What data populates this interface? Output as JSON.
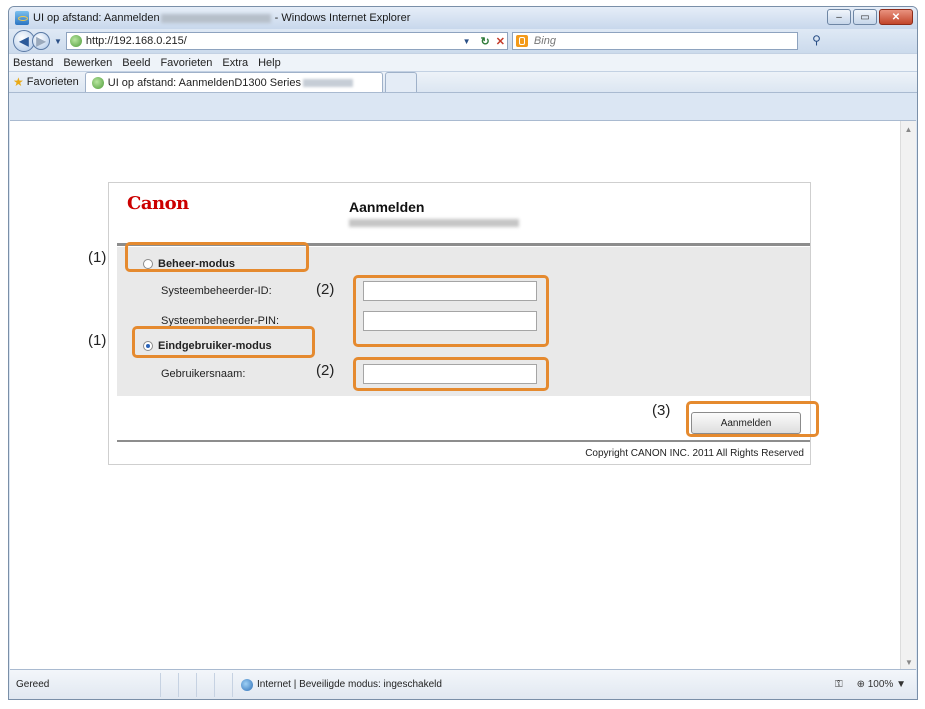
{
  "window": {
    "title_prefix": "UI op afstand: Aanmelden",
    "title_suffix": " - Windows Internet Explorer",
    "controls": [
      "–",
      "▭",
      "✕"
    ]
  },
  "navbar": {
    "back_icon": "back-arrow-icon",
    "url": "http://192.168.0.215/",
    "search_placeholder": "Bing",
    "search_icon": "⚲"
  },
  "menubar": {
    "items": [
      "Bestand",
      "Bewerken",
      "Beeld",
      "Favorieten",
      "Extra",
      "Help"
    ]
  },
  "favbar": {
    "favorites_label": "Favorieten",
    "tab_title": "UI op afstand: AanmeldenD1300 Series"
  },
  "login": {
    "brand": "Canon",
    "title": "Aanmelden",
    "admin_mode_label": "Beheer-modus",
    "sysadmin_id_label": "Systeembeheerder-ID:",
    "sysadmin_pin_label": "Systeembeheerder-PIN:",
    "enduser_mode_label": "Eindgebruiker-modus",
    "username_label": "Gebruikersnaam:",
    "login_button": "Aanmelden",
    "copyright": "Copyright CANON INC. 2011 All Rights Reserved",
    "selected_mode": "Eindgebruiker-modus"
  },
  "callouts": {
    "n1": "(1)",
    "n2": "(2)",
    "n3": "(3)",
    "color": "#e58a2f"
  },
  "statusbar": {
    "ready": "Gereed",
    "zone": "Internet | Beveiligde modus: ingeschakeld",
    "zoom": "100%",
    "zoom_icon": "⊕",
    "security_icon": "⚿"
  },
  "colors": {
    "canon_red": "#cc0000",
    "callout_orange": "#e58a2f"
  }
}
